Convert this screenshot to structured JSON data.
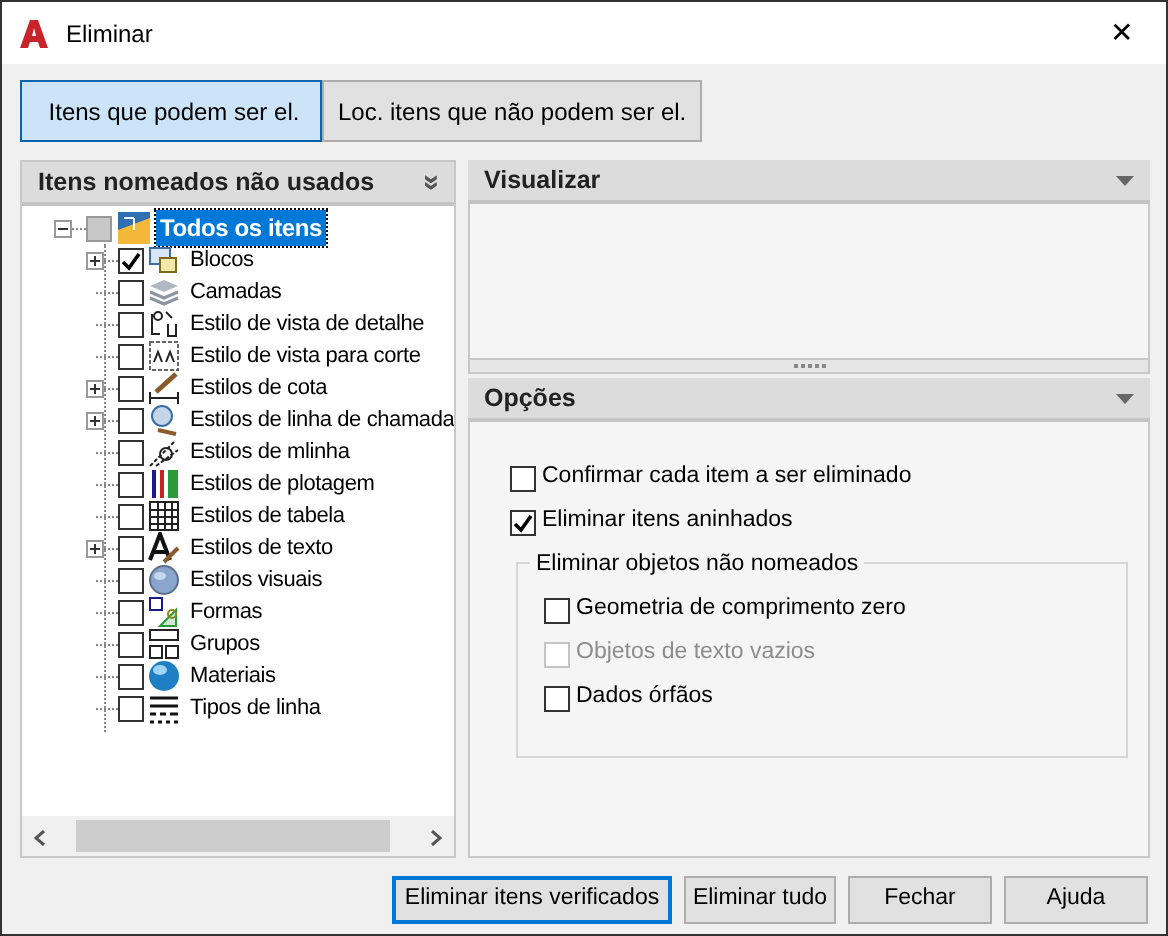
{
  "window": {
    "title": "Eliminar",
    "close": "✕"
  },
  "tabs": [
    {
      "label": "Itens que podem ser el.",
      "selected": true
    },
    {
      "label": "Loc. itens que não podem ser el.",
      "selected": false
    }
  ],
  "tree_panel": {
    "title": "Itens nomeados não usados",
    "collapse": "»",
    "root": {
      "label": "Todos os itens",
      "selected": true,
      "indeterminate": true,
      "expanded": true,
      "children": [
        {
          "label": "Blocos",
          "checked": true,
          "expandable": true
        },
        {
          "label": "Camadas",
          "checked": false,
          "expandable": false
        },
        {
          "label": "Estilo de vista de detalhe",
          "checked": false,
          "expandable": false
        },
        {
          "label": "Estilo de vista para corte",
          "checked": false,
          "expandable": false
        },
        {
          "label": "Estilos de cota",
          "checked": false,
          "expandable": true
        },
        {
          "label": "Estilos de linha de chamada",
          "checked": false,
          "expandable": true
        },
        {
          "label": "Estilos de mlinha",
          "checked": false,
          "expandable": false
        },
        {
          "label": "Estilos de plotagem",
          "checked": false,
          "expandable": false
        },
        {
          "label": "Estilos de tabela",
          "checked": false,
          "expandable": false
        },
        {
          "label": "Estilos de texto",
          "checked": false,
          "expandable": true
        },
        {
          "label": "Estilos visuais",
          "checked": false,
          "expandable": false
        },
        {
          "label": "Formas",
          "checked": false,
          "expandable": false
        },
        {
          "label": "Grupos",
          "checked": false,
          "expandable": false
        },
        {
          "label": "Materiais",
          "checked": false,
          "expandable": false
        },
        {
          "label": "Tipos de linha",
          "checked": false,
          "expandable": false
        }
      ]
    }
  },
  "preview_panel": {
    "title": "Visualizar"
  },
  "options_panel": {
    "title": "Opções",
    "options": [
      {
        "label": "Confirmar cada item a ser eliminado",
        "checked": false,
        "disabled": false
      },
      {
        "label": "Eliminar itens aninhados",
        "checked": true,
        "disabled": false
      }
    ],
    "group": {
      "title": "Eliminar objetos não nomeados",
      "options": [
        {
          "label": "Geometria de comprimento zero",
          "checked": false,
          "disabled": false
        },
        {
          "label": "Objetos de texto vazios",
          "checked": false,
          "disabled": true
        },
        {
          "label": "Dados órfãos",
          "checked": false,
          "disabled": false
        }
      ]
    }
  },
  "buttons": [
    {
      "label": "Eliminar itens verificados",
      "default": true
    },
    {
      "label": "Eliminar tudo",
      "default": false
    },
    {
      "label": "Fechar",
      "default": false
    },
    {
      "label": "Ajuda",
      "default": false
    }
  ]
}
